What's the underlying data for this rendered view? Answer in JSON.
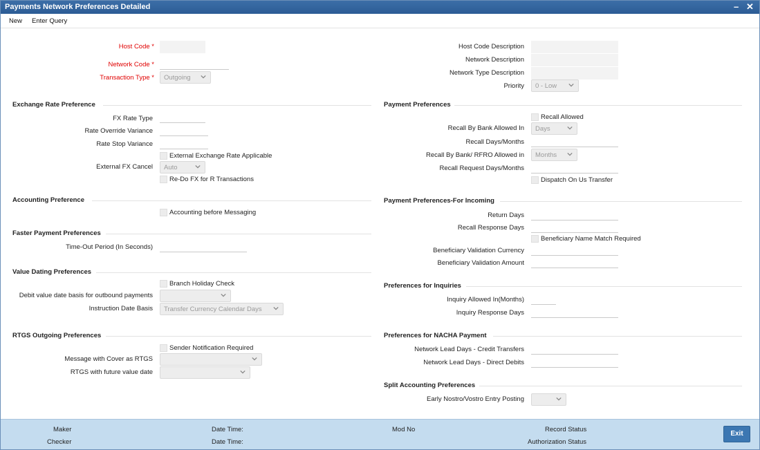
{
  "window": {
    "title": "Payments Network Preferences Detailed",
    "minimize": "–",
    "close": "✕"
  },
  "menu": {
    "new": "New",
    "enter_query": "Enter Query"
  },
  "header": {
    "host_code": {
      "label": "Host Code",
      "value": ""
    },
    "network_code": {
      "label": "Network Code",
      "value": ""
    },
    "transaction_type": {
      "label": "Transaction Type",
      "value": "Outgoing"
    },
    "host_code_description": {
      "label": "Host Code Description",
      "value": ""
    },
    "network_description": {
      "label": "Network Description",
      "value": ""
    },
    "network_type_description": {
      "label": "Network Type Description",
      "value": ""
    },
    "priority": {
      "label": "Priority",
      "value": "0 - Low"
    }
  },
  "exchange_rate": {
    "title": "Exchange Rate Preference",
    "fx_rate_type": "FX Rate Type",
    "rate_override_variance": "Rate Override Variance",
    "rate_stop_variance": "Rate Stop Variance",
    "external_rate_applicable": "External Exchange Rate Applicable",
    "external_fx_cancel": {
      "label": "External FX Cancel",
      "value": "Auto"
    },
    "redo_fx": "Re-Do FX for R Transactions"
  },
  "accounting": {
    "title": "Accounting Preference",
    "before_messaging": "Accounting before Messaging"
  },
  "faster_payment": {
    "title": "Faster Payment Preferences",
    "timeout": "Time-Out Period (In Seconds)"
  },
  "value_dating": {
    "title": "Value Dating Preferences",
    "branch_holiday": "Branch Holiday Check",
    "debit_value_date": {
      "label": "Debit value date basis for outbound payments",
      "value": ""
    },
    "instruction_date_basis": {
      "label": "Instruction Date Basis",
      "value": "Transfer Currency Calendar Days"
    }
  },
  "rtgs": {
    "title": "RTGS Outgoing Preferences",
    "sender_notification": "Sender Notification Required",
    "message_with_cover": {
      "label": "Message with Cover as RTGS",
      "value": ""
    },
    "future_value_date": {
      "label": "RTGS with future value date",
      "value": ""
    }
  },
  "payment_prefs": {
    "title": "Payment Preferences",
    "recall_allowed": "Recall Allowed",
    "recall_by_bank": {
      "label": "Recall By Bank Allowed In",
      "value": "Days"
    },
    "recall_days_months": "Recall Days/Months",
    "recall_rfro": {
      "label": "Recall By Bank/ RFRO Allowed in",
      "value": "Months"
    },
    "recall_request_days": "Recall Request Days/Months",
    "dispatch_on_us": "Dispatch On Us Transfer"
  },
  "incoming": {
    "title": "Payment Preferences-For Incoming",
    "return_days": "Return Days",
    "recall_response_days": "Recall Response Days",
    "beneficiary_name_match": "Beneficiary Name Match Required",
    "validation_currency": "Beneficiary Validation Currency",
    "validation_amount": "Beneficiary Validation Amount"
  },
  "inquiries": {
    "title": "Preferences for Inquiries",
    "allowed_in": "Inquiry Allowed In(Months)",
    "response_days": "Inquiry Response Days"
  },
  "nacha": {
    "title": "Preferences for NACHA Payment",
    "credit": "Network Lead Days - Credit Transfers",
    "debit": "Network Lead Days - Direct Debits"
  },
  "split_accounting": {
    "title": "Split Accounting Preferences",
    "early_nostro": {
      "label": "Early Nostro/Vostro Entry Posting",
      "value": ""
    }
  },
  "footer": {
    "maker": "Maker",
    "checker": "Checker",
    "date_time_1": "Date Time:",
    "date_time_2": "Date Time:",
    "mod_no": "Mod No",
    "record_status": "Record Status",
    "authorization_status": "Authorization Status",
    "exit": "Exit"
  }
}
